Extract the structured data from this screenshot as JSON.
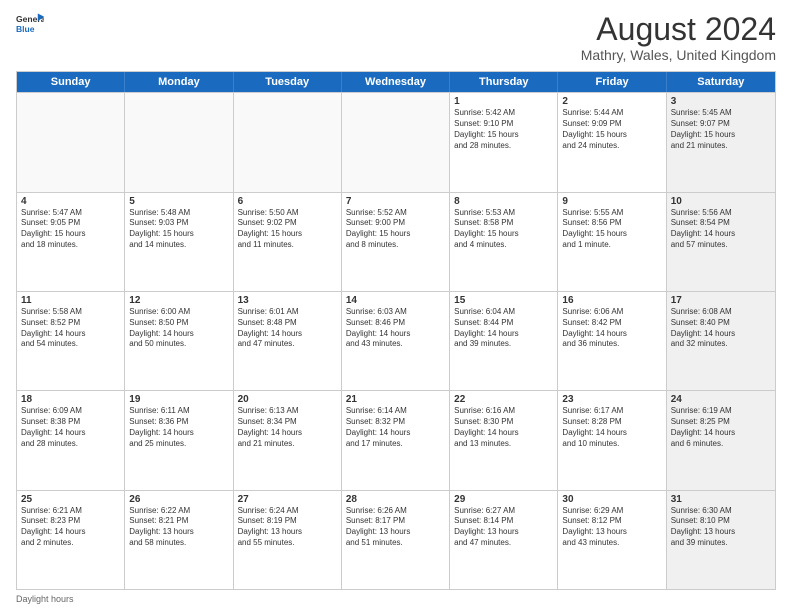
{
  "header": {
    "logo_line1": "General",
    "logo_line2": "Blue",
    "title": "August 2024",
    "subtitle": "Mathry, Wales, United Kingdom"
  },
  "days": [
    "Sunday",
    "Monday",
    "Tuesday",
    "Wednesday",
    "Thursday",
    "Friday",
    "Saturday"
  ],
  "footer": "Daylight hours",
  "rows": [
    [
      {
        "num": "",
        "text": "",
        "empty": true
      },
      {
        "num": "",
        "text": "",
        "empty": true
      },
      {
        "num": "",
        "text": "",
        "empty": true
      },
      {
        "num": "",
        "text": "",
        "empty": true
      },
      {
        "num": "1",
        "text": "Sunrise: 5:42 AM\nSunset: 9:10 PM\nDaylight: 15 hours\nand 28 minutes.",
        "empty": false
      },
      {
        "num": "2",
        "text": "Sunrise: 5:44 AM\nSunset: 9:09 PM\nDaylight: 15 hours\nand 24 minutes.",
        "empty": false
      },
      {
        "num": "3",
        "text": "Sunrise: 5:45 AM\nSunset: 9:07 PM\nDaylight: 15 hours\nand 21 minutes.",
        "empty": false,
        "shaded": true
      }
    ],
    [
      {
        "num": "4",
        "text": "Sunrise: 5:47 AM\nSunset: 9:05 PM\nDaylight: 15 hours\nand 18 minutes.",
        "empty": false
      },
      {
        "num": "5",
        "text": "Sunrise: 5:48 AM\nSunset: 9:03 PM\nDaylight: 15 hours\nand 14 minutes.",
        "empty": false
      },
      {
        "num": "6",
        "text": "Sunrise: 5:50 AM\nSunset: 9:02 PM\nDaylight: 15 hours\nand 11 minutes.",
        "empty": false
      },
      {
        "num": "7",
        "text": "Sunrise: 5:52 AM\nSunset: 9:00 PM\nDaylight: 15 hours\nand 8 minutes.",
        "empty": false
      },
      {
        "num": "8",
        "text": "Sunrise: 5:53 AM\nSunset: 8:58 PM\nDaylight: 15 hours\nand 4 minutes.",
        "empty": false
      },
      {
        "num": "9",
        "text": "Sunrise: 5:55 AM\nSunset: 8:56 PM\nDaylight: 15 hours\nand 1 minute.",
        "empty": false
      },
      {
        "num": "10",
        "text": "Sunrise: 5:56 AM\nSunset: 8:54 PM\nDaylight: 14 hours\nand 57 minutes.",
        "empty": false,
        "shaded": true
      }
    ],
    [
      {
        "num": "11",
        "text": "Sunrise: 5:58 AM\nSunset: 8:52 PM\nDaylight: 14 hours\nand 54 minutes.",
        "empty": false
      },
      {
        "num": "12",
        "text": "Sunrise: 6:00 AM\nSunset: 8:50 PM\nDaylight: 14 hours\nand 50 minutes.",
        "empty": false
      },
      {
        "num": "13",
        "text": "Sunrise: 6:01 AM\nSunset: 8:48 PM\nDaylight: 14 hours\nand 47 minutes.",
        "empty": false
      },
      {
        "num": "14",
        "text": "Sunrise: 6:03 AM\nSunset: 8:46 PM\nDaylight: 14 hours\nand 43 minutes.",
        "empty": false
      },
      {
        "num": "15",
        "text": "Sunrise: 6:04 AM\nSunset: 8:44 PM\nDaylight: 14 hours\nand 39 minutes.",
        "empty": false
      },
      {
        "num": "16",
        "text": "Sunrise: 6:06 AM\nSunset: 8:42 PM\nDaylight: 14 hours\nand 36 minutes.",
        "empty": false
      },
      {
        "num": "17",
        "text": "Sunrise: 6:08 AM\nSunset: 8:40 PM\nDaylight: 14 hours\nand 32 minutes.",
        "empty": false,
        "shaded": true
      }
    ],
    [
      {
        "num": "18",
        "text": "Sunrise: 6:09 AM\nSunset: 8:38 PM\nDaylight: 14 hours\nand 28 minutes.",
        "empty": false
      },
      {
        "num": "19",
        "text": "Sunrise: 6:11 AM\nSunset: 8:36 PM\nDaylight: 14 hours\nand 25 minutes.",
        "empty": false
      },
      {
        "num": "20",
        "text": "Sunrise: 6:13 AM\nSunset: 8:34 PM\nDaylight: 14 hours\nand 21 minutes.",
        "empty": false
      },
      {
        "num": "21",
        "text": "Sunrise: 6:14 AM\nSunset: 8:32 PM\nDaylight: 14 hours\nand 17 minutes.",
        "empty": false
      },
      {
        "num": "22",
        "text": "Sunrise: 6:16 AM\nSunset: 8:30 PM\nDaylight: 14 hours\nand 13 minutes.",
        "empty": false
      },
      {
        "num": "23",
        "text": "Sunrise: 6:17 AM\nSunset: 8:28 PM\nDaylight: 14 hours\nand 10 minutes.",
        "empty": false
      },
      {
        "num": "24",
        "text": "Sunrise: 6:19 AM\nSunset: 8:25 PM\nDaylight: 14 hours\nand 6 minutes.",
        "empty": false,
        "shaded": true
      }
    ],
    [
      {
        "num": "25",
        "text": "Sunrise: 6:21 AM\nSunset: 8:23 PM\nDaylight: 14 hours\nand 2 minutes.",
        "empty": false
      },
      {
        "num": "26",
        "text": "Sunrise: 6:22 AM\nSunset: 8:21 PM\nDaylight: 13 hours\nand 58 minutes.",
        "empty": false
      },
      {
        "num": "27",
        "text": "Sunrise: 6:24 AM\nSunset: 8:19 PM\nDaylight: 13 hours\nand 55 minutes.",
        "empty": false
      },
      {
        "num": "28",
        "text": "Sunrise: 6:26 AM\nSunset: 8:17 PM\nDaylight: 13 hours\nand 51 minutes.",
        "empty": false
      },
      {
        "num": "29",
        "text": "Sunrise: 6:27 AM\nSunset: 8:14 PM\nDaylight: 13 hours\nand 47 minutes.",
        "empty": false
      },
      {
        "num": "30",
        "text": "Sunrise: 6:29 AM\nSunset: 8:12 PM\nDaylight: 13 hours\nand 43 minutes.",
        "empty": false
      },
      {
        "num": "31",
        "text": "Sunrise: 6:30 AM\nSunset: 8:10 PM\nDaylight: 13 hours\nand 39 minutes.",
        "empty": false,
        "shaded": true
      }
    ]
  ]
}
